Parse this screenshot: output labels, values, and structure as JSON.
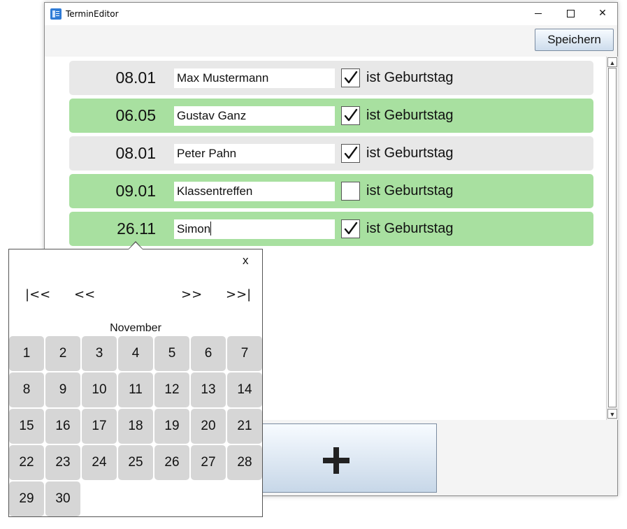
{
  "window": {
    "title": "TerminEditor"
  },
  "toolbar": {
    "save_label": "Speichern"
  },
  "entries": [
    {
      "date": "08.01",
      "name": "Max Mustermann",
      "checked": true,
      "checkbox_label": "ist Geburtstag",
      "row_color": "#e8e8e8"
    },
    {
      "date": "06.05",
      "name": "Gustav Ganz",
      "checked": true,
      "checkbox_label": "ist Geburtstag",
      "row_color": "#a8e0a0"
    },
    {
      "date": "08.01",
      "name": "Peter Pahn",
      "checked": true,
      "checkbox_label": "ist Geburtstag",
      "row_color": "#e8e8e8"
    },
    {
      "date": "09.01",
      "name": "Klassentreffen",
      "checked": false,
      "checkbox_label": "ist Geburtstag",
      "row_color": "#a8e0a0"
    },
    {
      "date": "26.11",
      "name": "Simon",
      "checked": true,
      "checkbox_label": "ist Geburtstag",
      "row_color": "#a8e0a0"
    }
  ],
  "add_button": {
    "icon": "plus-icon"
  },
  "date_picker": {
    "close_label": "x",
    "nav_first": "|<<",
    "nav_prev": "<<",
    "nav_next": ">>",
    "nav_last": ">>|",
    "month": "November",
    "days": [
      "1",
      "2",
      "3",
      "4",
      "5",
      "6",
      "7",
      "8",
      "9",
      "10",
      "11",
      "12",
      "13",
      "14",
      "15",
      "16",
      "17",
      "18",
      "19",
      "20",
      "21",
      "22",
      "23",
      "24",
      "25",
      "26",
      "27",
      "28",
      "29",
      "30"
    ]
  }
}
